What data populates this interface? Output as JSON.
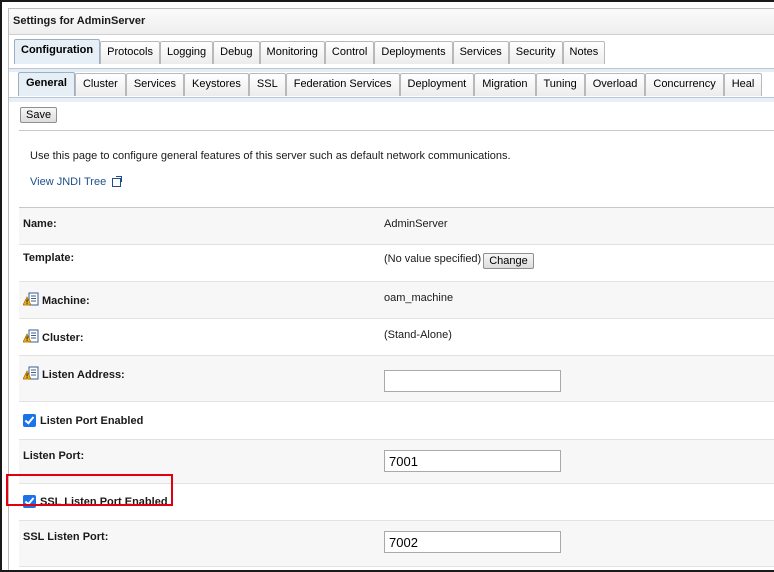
{
  "panel": {
    "title": "Settings for AdminServer"
  },
  "main_tabs": [
    {
      "label": "Configuration",
      "active": true
    },
    {
      "label": "Protocols"
    },
    {
      "label": "Logging"
    },
    {
      "label": "Debug"
    },
    {
      "label": "Monitoring"
    },
    {
      "label": "Control"
    },
    {
      "label": "Deployments"
    },
    {
      "label": "Services"
    },
    {
      "label": "Security"
    },
    {
      "label": "Notes"
    }
  ],
  "sub_tabs": [
    {
      "label": "General",
      "active": true
    },
    {
      "label": "Cluster"
    },
    {
      "label": "Services"
    },
    {
      "label": "Keystores"
    },
    {
      "label": "SSL"
    },
    {
      "label": "Federation Services"
    },
    {
      "label": "Deployment"
    },
    {
      "label": "Migration"
    },
    {
      "label": "Tuning"
    },
    {
      "label": "Overload"
    },
    {
      "label": "Concurrency"
    },
    {
      "label": "Heal"
    }
  ],
  "toolbar": {
    "save_label": "Save"
  },
  "intro": {
    "description": "Use this page to configure general features of this server such as default network communications.",
    "jndi_link": "View JNDI Tree"
  },
  "form": {
    "name": {
      "label": "Name:",
      "value": "AdminServer"
    },
    "template": {
      "label": "Template:",
      "value": "(No value specified)",
      "change_label": "Change"
    },
    "machine": {
      "label": "Machine:",
      "value": "oam_machine"
    },
    "cluster": {
      "label": "Cluster:",
      "value": "(Stand-Alone)"
    },
    "listen_address": {
      "label": "Listen Address:",
      "value": ""
    },
    "listen_port_enabled": {
      "label": "Listen Port Enabled",
      "checked": true
    },
    "listen_port": {
      "label": "Listen Port:",
      "value": "7001"
    },
    "ssl_listen_port_enabled": {
      "label": "SSL Listen Port Enabled",
      "checked": true
    },
    "ssl_listen_port": {
      "label": "SSL Listen Port:",
      "value": "7002"
    }
  },
  "colors": {
    "highlight": "#e0000f",
    "checkbox": "#1a73e8",
    "link": "#1f4e8c"
  },
  "icons": {
    "warning": "warning-restart-icon",
    "external": "external-link-icon"
  }
}
